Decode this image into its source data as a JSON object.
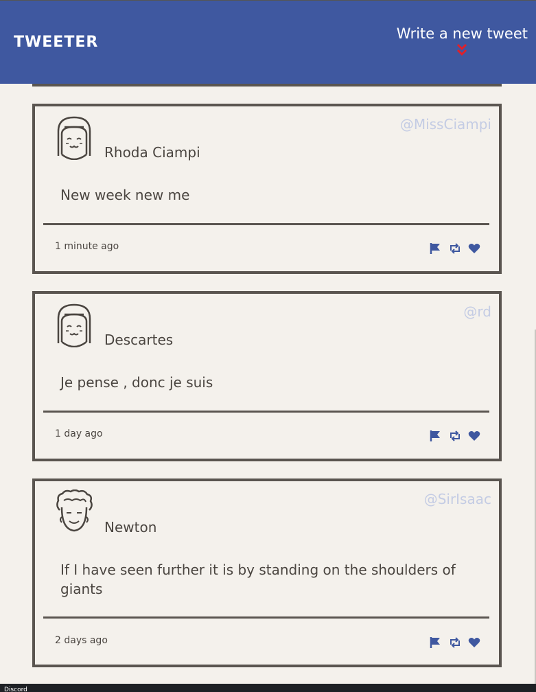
{
  "navbar": {
    "brand": "TWEETER",
    "compose_label": "Write a new tweet",
    "compose_icon": "double-chevron-down-icon",
    "brand_color": "#3f58a0",
    "chevron_color": "#e0202a"
  },
  "tweets": [
    {
      "name": "Rhoda Ciampi",
      "handle": "@MissCiampi",
      "content": "New week new me",
      "time": "1 minute ago",
      "avatar": "girl-avatar-icon"
    },
    {
      "name": "Descartes",
      "handle": "@rd",
      "content": "Je pense , donc je suis",
      "time": "1 day ago",
      "avatar": "girl-avatar-icon"
    },
    {
      "name": "Newton",
      "handle": "@SirIsaac",
      "content": "If I have seen further it is by standing on the shoulders of giants",
      "time": "2 days ago",
      "avatar": "curly-hair-avatar-icon"
    }
  ],
  "actions": [
    "flag-icon",
    "retweet-icon",
    "heart-icon"
  ],
  "footer": {
    "text": "Discord"
  },
  "colors": {
    "background": "#f4f1ec",
    "border": "#5a5550",
    "action_icons": "#3f58a0",
    "handle": "#c4cce4"
  }
}
